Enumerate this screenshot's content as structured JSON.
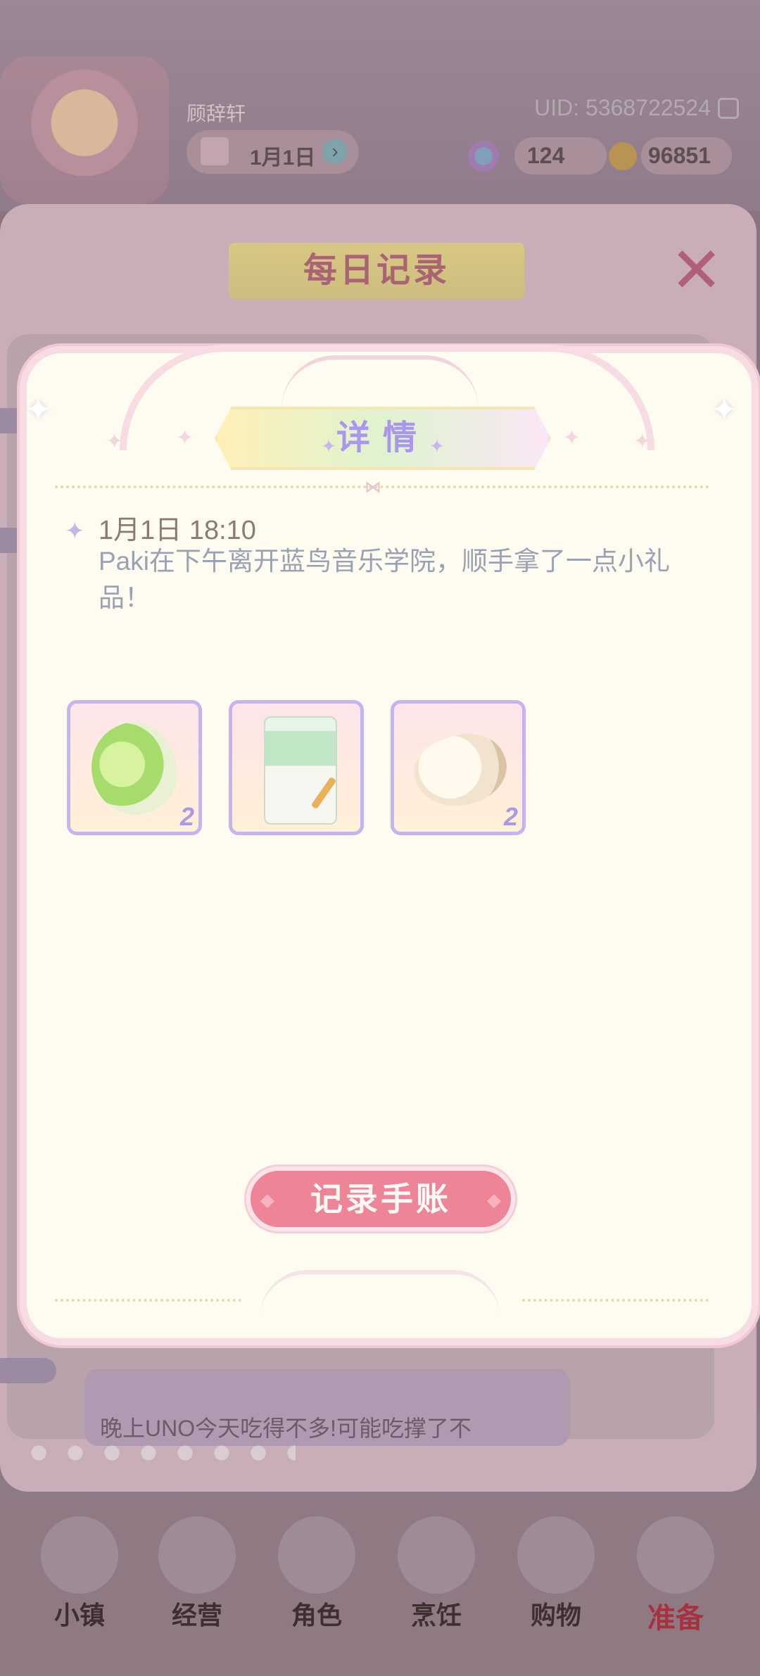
{
  "topbar": {
    "username": "顾辞轩",
    "uid": "UID: 5368722524",
    "date": "1月1日",
    "gems": "124",
    "coins": "96851"
  },
  "background_panel": {
    "title": "每日记录",
    "close": "✕",
    "peek_text": "晚上UNO今天吃得不多!可能吃撑了不"
  },
  "modal": {
    "title": "详情",
    "entry": {
      "time": "1月1日 18:10",
      "text": "Paki在下午离开蓝鸟音乐学院，顺手拿了一点小礼品！"
    },
    "items": [
      {
        "icon": "cabbage-icon",
        "count": "2"
      },
      {
        "icon": "flour-bag-icon",
        "count": ""
      },
      {
        "icon": "cotton-icon",
        "count": "2"
      }
    ],
    "action_button": "记录手账"
  },
  "bottom_nav": [
    {
      "label": "小镇",
      "icon": "town-map-icon",
      "active": false
    },
    {
      "label": "经营",
      "icon": "top-hat-icon",
      "active": false
    },
    {
      "label": "角色",
      "icon": "character-icon",
      "active": false
    },
    {
      "label": "烹饪",
      "icon": "sandwich-icon",
      "active": false
    },
    {
      "label": "购物",
      "icon": "shopping-bag-icon",
      "active": false
    },
    {
      "label": "准备",
      "icon": "basket-icon",
      "active": true
    }
  ],
  "colors": {
    "accent_pink": "#ee8596",
    "title_purple": "#a997ea",
    "modal_bg": "#fefcf0"
  }
}
